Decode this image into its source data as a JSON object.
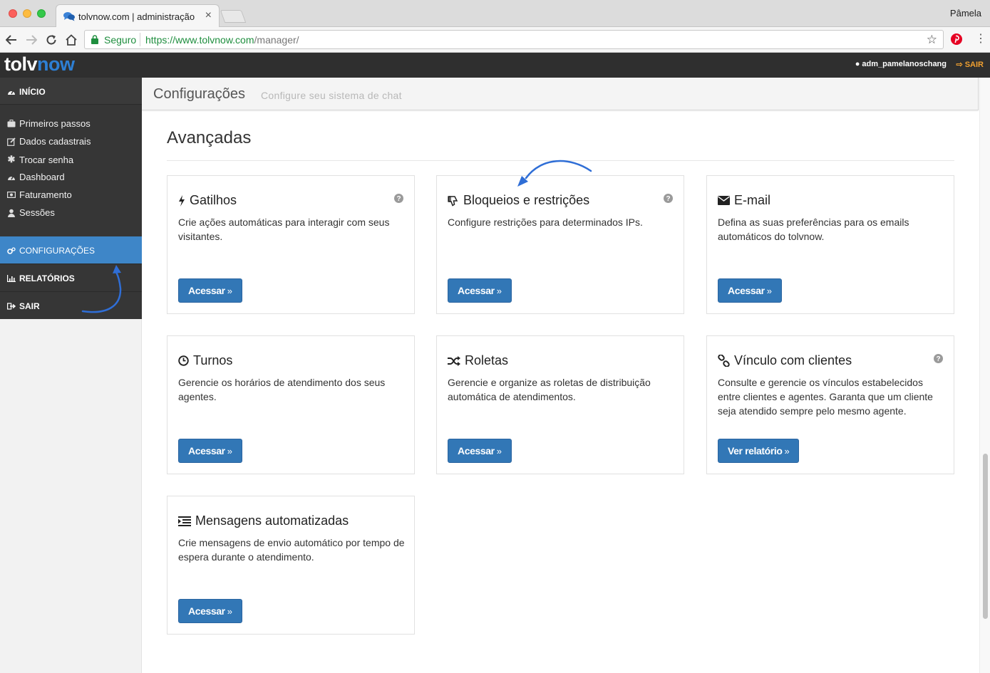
{
  "browser": {
    "tab_title": "tolvnow.com | administração",
    "profile_name": "Pâmela",
    "secure_label": "Seguro",
    "url_host": "https://www.tolvnow.com",
    "url_path": "/manager/"
  },
  "app": {
    "logo_part1": "tolv",
    "logo_part2": "now",
    "brand_color": "#2d7fd4",
    "username": "adm_pamelanoschang",
    "logout_label": "SAIR"
  },
  "sidebar": {
    "home_label": "INÍCIO",
    "sub_items": [
      {
        "label": "Primeiros passos",
        "icon": "briefcase-icon"
      },
      {
        "label": "Dados cadastrais",
        "icon": "edit-icon"
      },
      {
        "label": "Trocar senha",
        "icon": "asterisk-icon"
      },
      {
        "label": "Dashboard",
        "icon": "dashboard-icon"
      },
      {
        "label": "Faturamento",
        "icon": "money-icon"
      },
      {
        "label": "Sessões",
        "icon": "user-icon"
      }
    ],
    "config_label": "CONFIGURAÇÕES",
    "reports_label": "RELATÓRIOS",
    "exit_label": "SAIR",
    "active_color": "#3e86c8"
  },
  "header": {
    "title": "Configurações",
    "subtitle": "Configure seu sistema de chat"
  },
  "section": {
    "title": "Avançadas"
  },
  "cards": [
    {
      "title": "Gatilhos",
      "icon": "bolt-icon",
      "help": true,
      "description": "Crie ações automáticas para interagir com seus visitantes.",
      "button": "Acessar"
    },
    {
      "title": "Bloqueios e restrições",
      "icon": "thumbs-down-icon",
      "help": true,
      "description": "Configure restrições para determinados IPs.",
      "button": "Acessar"
    },
    {
      "title": "E-mail",
      "icon": "envelope-icon",
      "help": false,
      "description": "Defina as suas preferências para os emails automáticos do tolvnow.",
      "button": "Acessar"
    },
    {
      "title": "Turnos",
      "icon": "clock-icon",
      "help": false,
      "description": "Gerencie os horários de atendimento dos seus agentes.",
      "button": "Acessar"
    },
    {
      "title": "Roletas",
      "icon": "random-icon",
      "help": false,
      "description": "Gerencie e organize as roletas de distribuição automática de atendimentos.",
      "button": "Acessar"
    },
    {
      "title": "Vínculo com clientes",
      "icon": "link-icon",
      "help": true,
      "description": "Consulte e gerencie os vínculos estabelecidos entre clientes e agentes. Garanta que um cliente seja atendido sempre pelo mesmo agente.",
      "button": "Ver relatório"
    },
    {
      "title": "Mensagens automatizadas",
      "icon": "indent-icon",
      "help": false,
      "description": "Crie mensagens de envio automático por tempo de espera durante o atendimento.",
      "button": "Acessar"
    }
  ],
  "button_color": "#3277b6"
}
